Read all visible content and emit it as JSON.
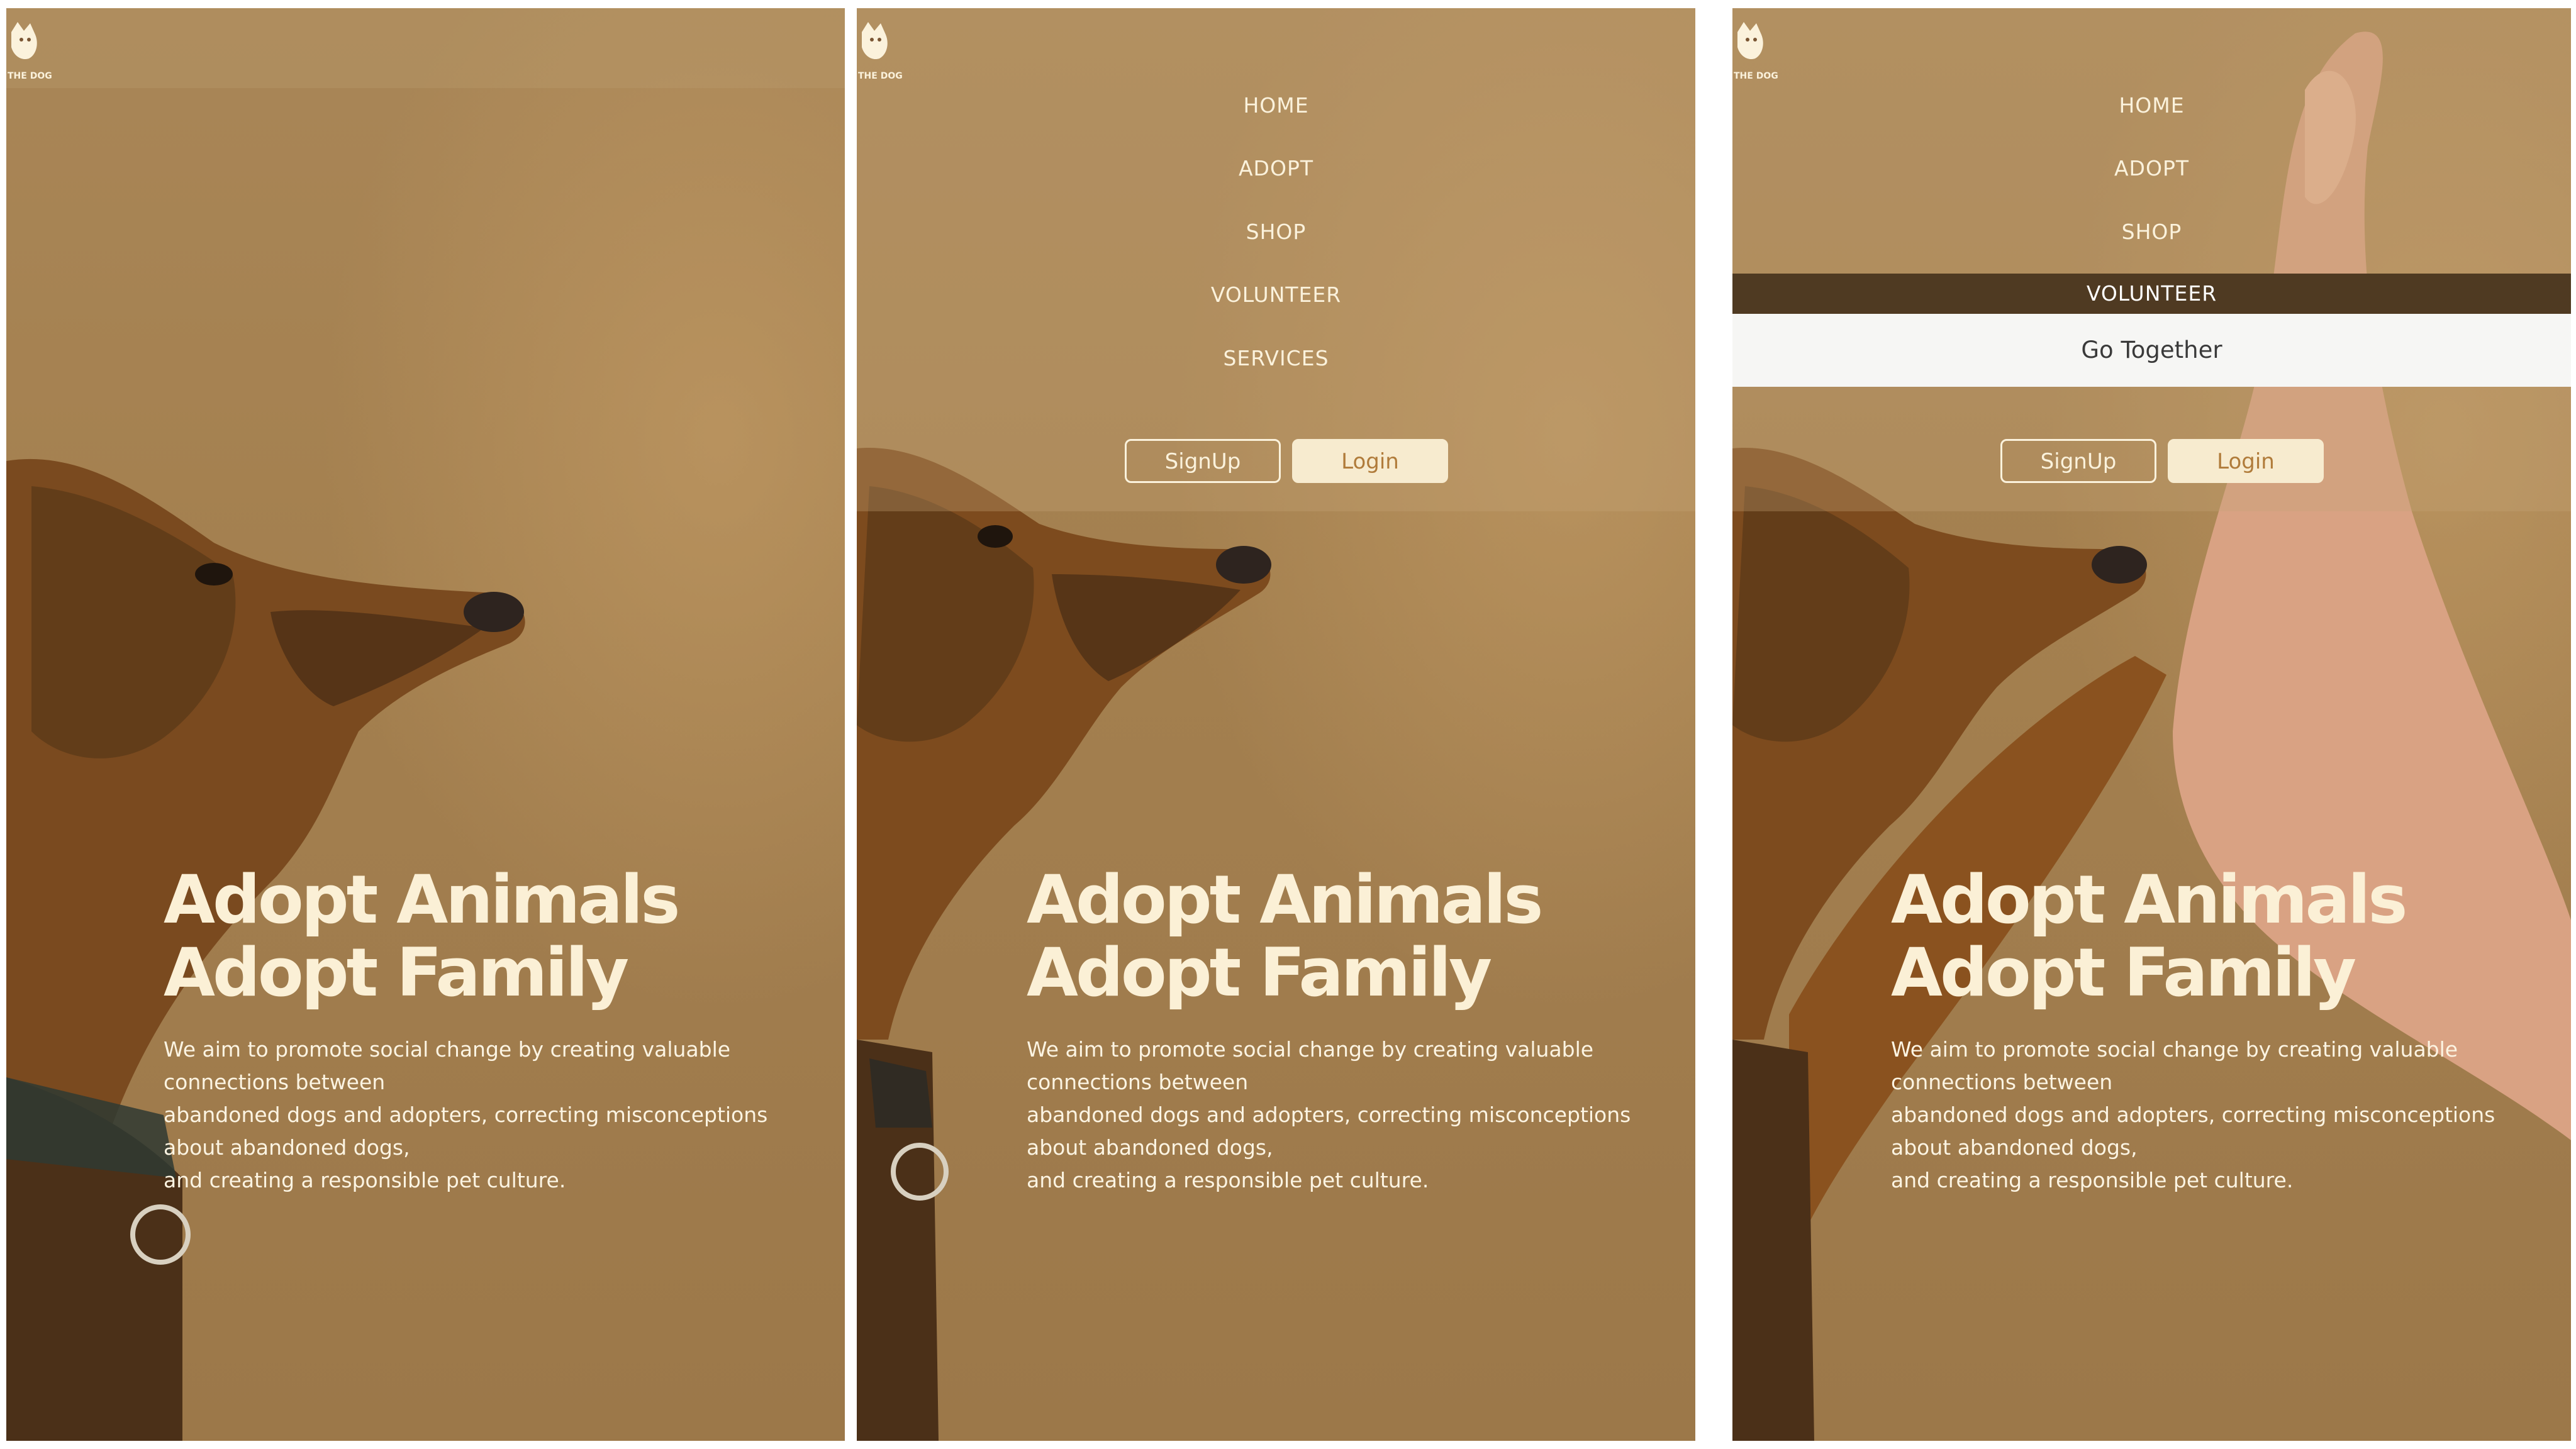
{
  "brand": {
    "logo_text": "THE DOG"
  },
  "nav": {
    "items": [
      "HOME",
      "ADOPT",
      "SHOP",
      "VOLUNTEER",
      "SERVICES"
    ],
    "active": "VOLUNTEER",
    "submenu": [
      "Go Together"
    ]
  },
  "auth": {
    "signup_label": "SignUp",
    "login_label": "Login"
  },
  "hero": {
    "title_line1": "Adopt Animals",
    "title_line2": "Adopt Family",
    "description": [
      "We aim to promote social change by creating valuable",
      "connections between",
      "abandoned dogs and adopters, correcting misconceptions",
      "about abandoned dogs,",
      "and creating a responsible pet culture."
    ]
  },
  "colors": {
    "background": "#a4804f",
    "cream": "#f7ebcf",
    "login_text": "#b07b3a",
    "active_nav": "#4f3a22"
  }
}
